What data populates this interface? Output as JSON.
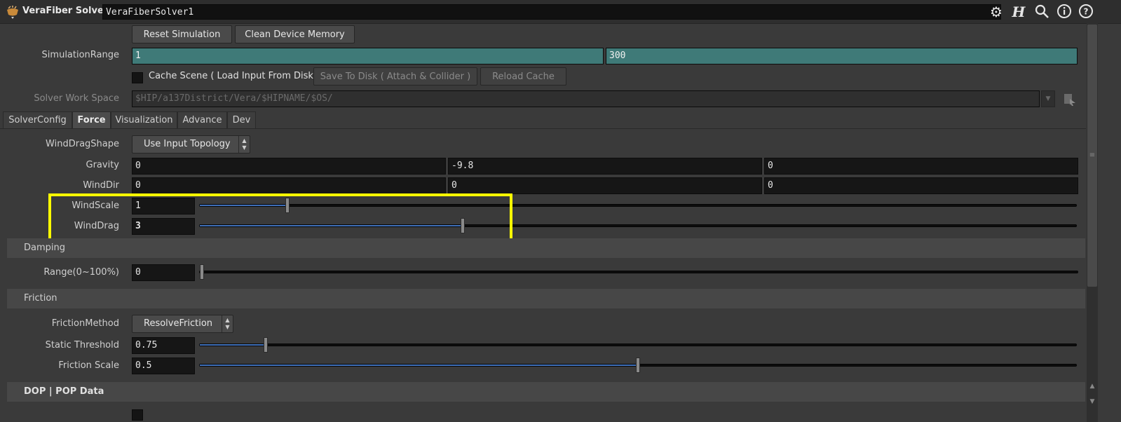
{
  "header": {
    "node_type": "VeraFiber Solver",
    "node_name": "VeraFiberSolver1",
    "icons": [
      "node-icon",
      "gear-icon",
      "houdini-h-icon",
      "search-icon",
      "info-icon",
      "help-icon"
    ]
  },
  "buttons": {
    "reset_simulation": "Reset Simulation",
    "clean_device_memory": "Clean Device Memory",
    "save_to_disk": "Save To Disk ( Attach & Collider )",
    "reload_cache": "Reload Cache"
  },
  "simulation_range": {
    "label": "SimulationRange",
    "start": "1",
    "end": "300"
  },
  "cache_scene": {
    "label": "Cache Scene ( Load Input From Disk )",
    "checked": false
  },
  "solver_work_space": {
    "label": "Solver Work Space",
    "value": "$HIP/a137District/Vera/$HIPNAME/$OS/"
  },
  "tabs": [
    {
      "label": "SolverConfig",
      "active": false
    },
    {
      "label": "Force",
      "active": true
    },
    {
      "label": "Visualization",
      "active": false
    },
    {
      "label": "Advance",
      "active": false
    },
    {
      "label": "Dev",
      "active": false
    }
  ],
  "force": {
    "wind_drag_shape": {
      "label": "WindDragShape",
      "value": "Use Input Topology"
    },
    "gravity": {
      "label": "Gravity",
      "values": [
        "0",
        "-9.8",
        "0"
      ]
    },
    "wind_dir": {
      "label": "WindDir",
      "values": [
        "0",
        "0",
        "0"
      ]
    },
    "wind_scale": {
      "label": "WindScale",
      "value": "1",
      "slider_fraction": 0.1
    },
    "wind_drag": {
      "label": "WindDrag",
      "value": "3",
      "slider_fraction": 0.3
    }
  },
  "damping": {
    "title": "Damping",
    "range": {
      "label": "Range(0~100%)",
      "value": "0",
      "slider_fraction": 0.0
    }
  },
  "friction": {
    "title": "Friction",
    "method": {
      "label": "FrictionMethod",
      "value": "ResolveFriction"
    },
    "static_threshold": {
      "label": "Static Threshold",
      "value": "0.75",
      "slider_fraction": 0.075
    },
    "friction_scale": {
      "label": "Friction Scale",
      "value": "0.5",
      "slider_fraction": 0.5
    }
  },
  "dop_pop_data": {
    "title": "DOP | POP Data"
  },
  "colors": {
    "highlight": "#ffff00",
    "teal_field": "#3f7a78",
    "slider_fill": "#3f6fb8"
  }
}
